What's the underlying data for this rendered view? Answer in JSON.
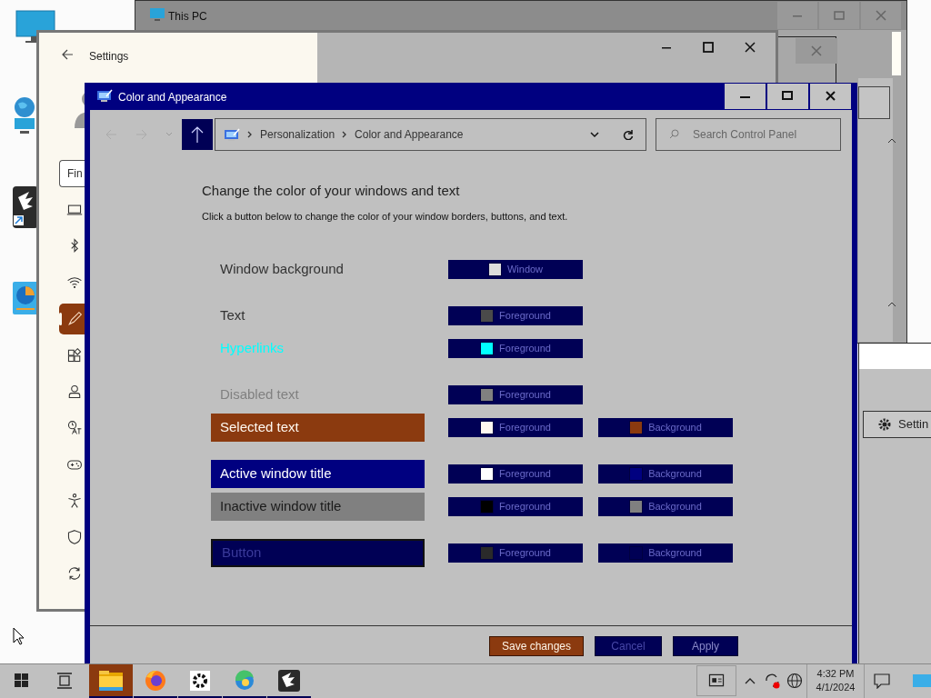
{
  "this_pc_window": {
    "title": "This PC"
  },
  "settings_window": {
    "title": "Settings",
    "search": {
      "placeholder": "Fin"
    },
    "nav": [
      {
        "kind": "display",
        "selected": false
      },
      {
        "kind": "bluetooth",
        "selected": false
      },
      {
        "kind": "wifi",
        "selected": false
      },
      {
        "kind": "brush",
        "selected": true
      },
      {
        "kind": "apps",
        "selected": false
      },
      {
        "kind": "account",
        "selected": false
      },
      {
        "kind": "time",
        "selected": false
      },
      {
        "kind": "gaming",
        "selected": false
      },
      {
        "kind": "accessibility",
        "selected": false
      },
      {
        "kind": "shield",
        "selected": false
      },
      {
        "kind": "update",
        "selected": false
      }
    ]
  },
  "right_window": {
    "button": "Settin"
  },
  "main_window": {
    "title": "Color and Appearance",
    "breadcrumb": [
      "Personalization",
      "Color and Appearance"
    ],
    "search": {
      "placeholder": "Search Control Panel"
    },
    "heading": "Change the color of your windows and text",
    "instructions": "Click a button below to change the color of your window borders, buttons, and text.",
    "groups": [
      {
        "rows": [
          {
            "label": "Window background",
            "color": "#333333",
            "buttons": [
              {
                "text": "Window",
                "color": "#dcdcdc"
              }
            ]
          }
        ]
      },
      {
        "rows": [
          {
            "label": "Text",
            "color": "#333333",
            "buttons": [
              {
                "text": "Foreground",
                "color": "#4a4a4a"
              }
            ]
          },
          {
            "label": "Hyperlinks",
            "color": "#00ffff",
            "buttons": [
              {
                "text": "Foreground",
                "color": "#00ffff"
              }
            ]
          }
        ]
      },
      {
        "rows": [
          {
            "label": "Disabled text",
            "color": "#808080",
            "buttons": [
              {
                "text": "Foreground",
                "color": "#808080"
              }
            ]
          },
          {
            "label": "Selected text",
            "color": "#fff8f0",
            "fill": {
              "color": "#8b3a0f"
            },
            "buttons": [
              {
                "text": "Foreground",
                "color": "#fff8f0"
              },
              {
                "text": "Background",
                "color": "#8b3a0f"
              }
            ]
          }
        ]
      },
      {
        "rows": [
          {
            "label": "Active window title",
            "color": "#ffffff",
            "fill": {
              "color": "#000080"
            },
            "buttons": [
              {
                "text": "Foreground",
                "color": "#ffffff"
              },
              {
                "text": "Background",
                "color": "#000080"
              }
            ]
          },
          {
            "label": "Inactive window title",
            "color": "#1a1a1a",
            "fill": {
              "color": "#808080"
            },
            "buttons": [
              {
                "text": "Foreground",
                "color": "#000000"
              },
              {
                "text": "Background",
                "color": "#808080"
              }
            ]
          }
        ]
      },
      {
        "rows": [
          {
            "label": "Button",
            "color": "#3a3a9a",
            "fill": {
              "color": "#000055"
            },
            "buttons": [
              {
                "text": "Foreground",
                "color": "#2a2a2a"
              },
              {
                "text": "Background",
                "color": "#000055"
              }
            ]
          }
        ]
      }
    ],
    "buttons": [
      {
        "label": "Save changes",
        "kind": "primary",
        "disabled": false
      },
      {
        "label": "Cancel",
        "kind": "normal",
        "disabled": true
      },
      {
        "label": "Apply",
        "kind": "normal",
        "disabled": false
      }
    ]
  },
  "taskbar": {
    "apps": [
      {
        "kind": "folder",
        "selected": true
      },
      {
        "kind": "firefox",
        "selected": false
      },
      {
        "kind": "gear",
        "selected": false
      },
      {
        "kind": "globe",
        "selected": false
      },
      {
        "kind": "eagle",
        "selected": false
      }
    ],
    "time": "4:32 PM",
    "date": "4/1/2024"
  }
}
